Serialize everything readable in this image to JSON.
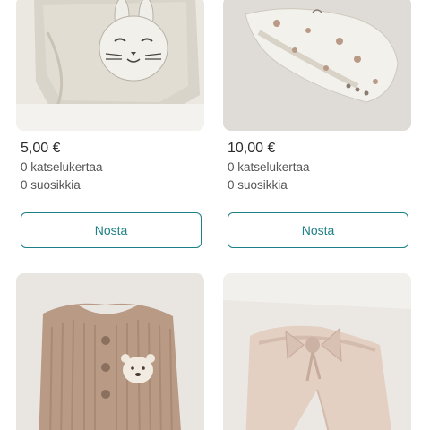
{
  "listings": [
    {
      "price": "5,00 €",
      "views": "0 katselukertaa",
      "favorites": "0 suosikkia",
      "button_label": "Nosta",
      "photo_subject": "bunny-face-bodysuit"
    },
    {
      "price": "10,00 €",
      "views": "0 katselukertaa",
      "favorites": "0 suosikkia",
      "button_label": "Nosta",
      "photo_subject": "animal-print-bodysuit"
    },
    {
      "photo_subject": "ribbed-romper-with-bear-patch"
    },
    {
      "photo_subject": "pink-pants-with-bow"
    }
  ],
  "colors": {
    "accent": "#1f7f86",
    "price_text": "#2b2b2b",
    "stat_text": "#555555"
  }
}
